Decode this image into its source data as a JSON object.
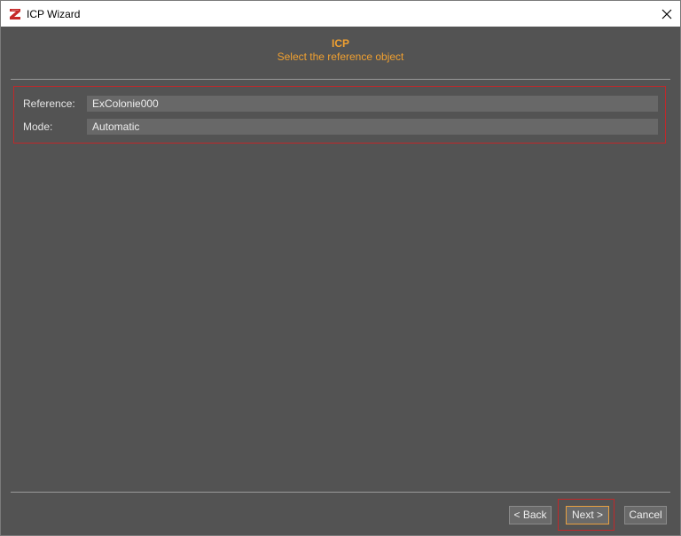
{
  "window": {
    "title": "ICP Wizard",
    "close_icon": "close-icon",
    "app_icon": "app-logo-icon"
  },
  "header": {
    "title": "ICP",
    "subtitle": "Select the reference object"
  },
  "form": {
    "reference_label": "Reference:",
    "reference_value": "ExColonie000",
    "mode_label": "Mode:",
    "mode_value": "Automatic"
  },
  "footer": {
    "back_label": "< Back",
    "next_label": "Next >",
    "cancel_label": "Cancel"
  },
  "colors": {
    "background": "#535353",
    "accent": "#f0a030",
    "highlight": "#c0282a"
  }
}
